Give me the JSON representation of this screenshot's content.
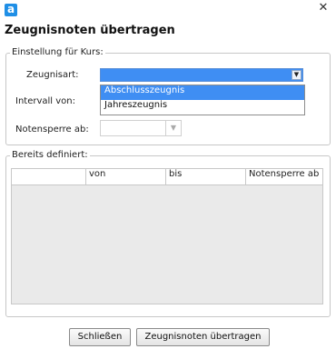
{
  "window": {
    "app_icon": "a",
    "close_glyph": "✕",
    "title": "Zeugnisnoten übertragen"
  },
  "settings": {
    "legend": "Einstellung für Kurs:",
    "zeugnisart_label": "Zeugnisart:",
    "zeugnisart_value": "",
    "zeugnisart_options": [
      "Abschlusszeugnis",
      "Jahreszeugnis"
    ],
    "intervall_label": "Intervall von:",
    "notensperre_label": "Notensperre ab:",
    "notensperre_value": ""
  },
  "defined": {
    "legend": "Bereits definiert:",
    "columns": [
      "",
      "von",
      "bis",
      "Notensperre ab"
    ]
  },
  "buttons": {
    "close": "Schließen",
    "transfer": "Zeugnisnoten übertragen"
  },
  "icons": {
    "combo_arrow": "chevron-down-icon",
    "close": "close-icon"
  },
  "colors": {
    "selection": "#3f8ef3",
    "app_icon": "#1f8fe6"
  }
}
